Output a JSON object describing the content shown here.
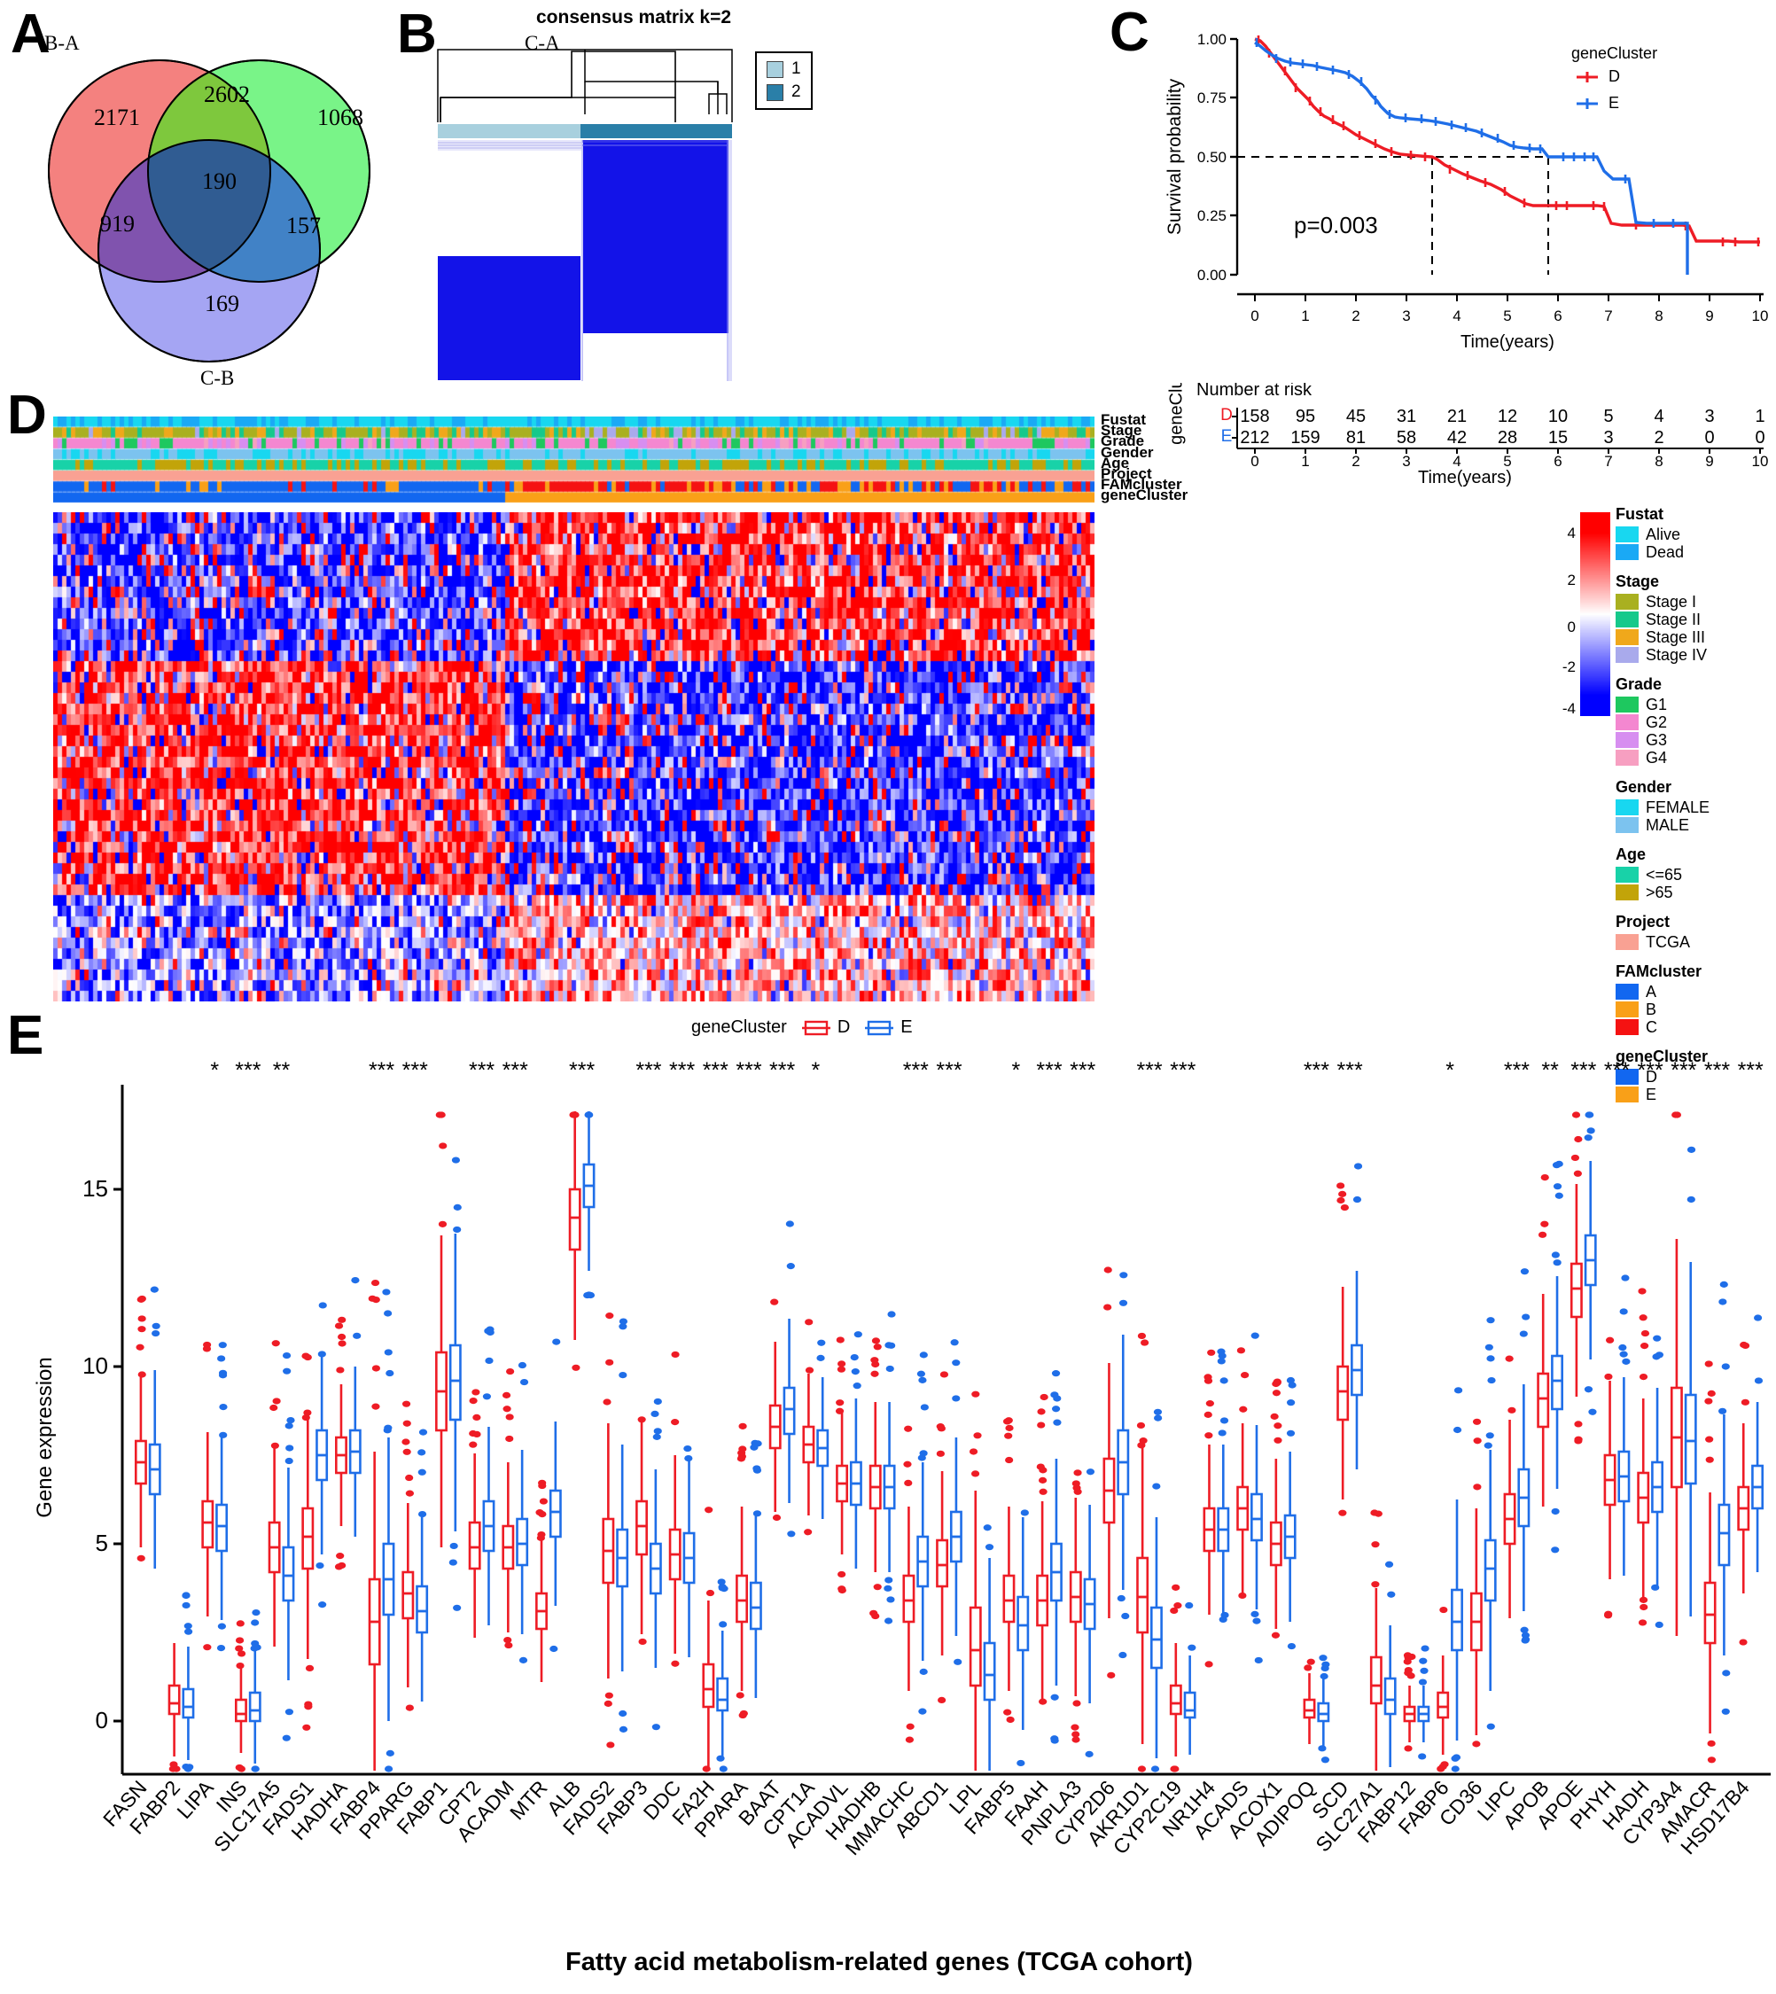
{
  "figure": {
    "panels": [
      "A",
      "B",
      "C",
      "D",
      "E"
    ]
  },
  "panelA": {
    "letter": "A",
    "type": "venn",
    "set_labels": [
      "B-A",
      "C-A",
      "C-B"
    ],
    "regions": [
      {
        "name": "B-A only",
        "value": "2171"
      },
      {
        "name": "B-A ∩ C-A",
        "value": "2602"
      },
      {
        "name": "C-A only",
        "value": "1068"
      },
      {
        "name": "B-A ∩ C-B",
        "value": "919"
      },
      {
        "name": "triple",
        "value": "190"
      },
      {
        "name": "C-A ∩ C-B",
        "value": "157"
      },
      {
        "name": "C-B only",
        "value": "169"
      }
    ],
    "colors": {
      "red": "#f4817f",
      "green": "#66f278",
      "blue": "#8e8ef0"
    }
  },
  "panelB": {
    "letter": "B",
    "title": "consensus matrix k=2",
    "legend_title": "",
    "legend_items": [
      {
        "label": "1",
        "color": "#a8d0de"
      },
      {
        "label": "2",
        "color": "#2a7fa8"
      }
    ],
    "matrix_color": "#1313e8",
    "k": "2"
  },
  "panelC": {
    "letter": "C",
    "ylabel": "Survival probability",
    "xlabel": "Time(years)",
    "pvalue": "p=0.003",
    "ylim": [
      0,
      1
    ],
    "yticks": [
      "0.00",
      "0.25",
      "0.50",
      "0.75",
      "1.00"
    ],
    "xticks": [
      "0",
      "1",
      "2",
      "3",
      "4",
      "5",
      "6",
      "7",
      "8",
      "9",
      "10"
    ],
    "legend_title": "geneCluster",
    "legend_items": [
      {
        "label": "D",
        "color": "#ee1c25"
      },
      {
        "label": "E",
        "color": "#1f6ee8"
      }
    ],
    "median_lines": {
      "y": "0.50",
      "x_D": "3.5",
      "x_E": "5.8"
    },
    "risk_title": "Number at risk",
    "risk_axis_label": "geneCluster",
    "risk_rows": [
      {
        "label": "D",
        "color": "#ee1c25",
        "values": [
          "158",
          "95",
          "45",
          "31",
          "21",
          "12",
          "10",
          "5",
          "4",
          "3",
          "1"
        ]
      },
      {
        "label": "E",
        "color": "#1f6ee8",
        "values": [
          "212",
          "159",
          "81",
          "58",
          "42",
          "28",
          "15",
          "3",
          "2",
          "0",
          "0"
        ]
      }
    ]
  },
  "panelD": {
    "letter": "D",
    "annotation_rows": [
      "Fustat",
      "Stage",
      "Grade",
      "Gender",
      "Age",
      "Project",
      "FAMcluster",
      "geneCluster"
    ],
    "colorbar_ticks": [
      "4",
      "2",
      "0",
      "-2",
      "-4"
    ],
    "legend_groups": [
      {
        "title": "Fustat",
        "items": [
          {
            "label": "Alive",
            "color": "#18d7f0"
          },
          {
            "label": "Dead",
            "color": "#1aa9f5"
          }
        ]
      },
      {
        "title": "Stage",
        "items": [
          {
            "label": "Stage I",
            "color": "#a9b020"
          },
          {
            "label": "Stage II",
            "color": "#16c98b"
          },
          {
            "label": "Stage III",
            "color": "#f0a81b"
          },
          {
            "label": "Stage IV",
            "color": "#a9aaec"
          }
        ]
      },
      {
        "title": "Grade",
        "items": [
          {
            "label": "G1",
            "color": "#1ec85f"
          },
          {
            "label": "G2",
            "color": "#f487d0"
          },
          {
            "label": "G3",
            "color": "#d78ef0"
          },
          {
            "label": "G4",
            "color": "#f79fc1"
          }
        ]
      },
      {
        "title": "Gender",
        "items": [
          {
            "label": "FEMALE",
            "color": "#18d7f0"
          },
          {
            "label": "MALE",
            "color": "#7cc3ef"
          }
        ]
      },
      {
        "title": "Age",
        "items": [
          {
            "label": "<=65",
            "color": "#18d2a8"
          },
          {
            "label": ">65",
            "color": "#c2a409"
          }
        ]
      },
      {
        "title": "Project",
        "items": [
          {
            "label": "TCGA",
            "color": "#f9a193"
          }
        ]
      },
      {
        "title": "FAMcluster",
        "items": [
          {
            "label": "A",
            "color": "#1267f0"
          },
          {
            "label": "B",
            "color": "#f9a018"
          },
          {
            "label": "C",
            "color": "#f51212"
          }
        ]
      },
      {
        "title": "geneCluster",
        "items": [
          {
            "label": "D",
            "color": "#1267f0"
          },
          {
            "label": "E",
            "color": "#f9a018"
          }
        ]
      }
    ]
  },
  "panelE": {
    "letter": "E",
    "ylabel": "Gene expression",
    "xlabel": "Fatty acid metabolism-related genes (TCGA cohort)",
    "legend_title": "geneCluster",
    "legend_items": [
      {
        "label": "D",
        "color": "#ee1c25"
      },
      {
        "label": "E",
        "color": "#1f6ee8"
      }
    ],
    "yticks": [
      "0",
      "5",
      "10",
      "15"
    ],
    "ylim": [
      -1.5,
      17.5
    ],
    "genes": [
      "FASN",
      "FABP2",
      "LIPA",
      "INS",
      "SLC17A5",
      "FADS1",
      "HADHA",
      "FABP4",
      "PPARG",
      "FABP1",
      "CPT2",
      "ACADM",
      "MTR",
      "ALB",
      "FADS2",
      "FABP3",
      "DDC",
      "FA2H",
      "PPARA",
      "BAAT",
      "CPT1A",
      "ACADVL",
      "HADHB",
      "MMACHC",
      "ABCD1",
      "LPL",
      "FABP5",
      "FAAH",
      "PNPLA3",
      "CYP2D6",
      "AKR1D1",
      "CYP2C19",
      "NR1H4",
      "ACADS",
      "ACOX1",
      "ADIPOQ",
      "SCD",
      "SLC27A1",
      "FABP12",
      "FABP6",
      "CD36",
      "LIPC",
      "APOB",
      "APOE",
      "PHYH",
      "HADH",
      "CYP3A4",
      "AMACR",
      "HSD17B4"
    ],
    "significance": [
      "",
      "",
      "*",
      "***",
      "**",
      "",
      "",
      "***",
      "***",
      "",
      "***",
      "***",
      "",
      "***",
      "",
      "***",
      "***",
      "***",
      "***",
      "***",
      "*",
      "",
      "",
      "***",
      "***",
      "",
      "*",
      "***",
      "***",
      "",
      "***",
      "***",
      "",
      "",
      "",
      "***",
      "***",
      "",
      "",
      "*",
      "",
      "***",
      "**",
      "***",
      "***",
      "***",
      "***",
      "***",
      "***"
    ]
  },
  "chart_data": [
    {
      "type": "venn",
      "title": "",
      "sets": [
        "B-A",
        "C-A",
        "C-B"
      ],
      "counts": {
        "B-A_only": 2171,
        "C-A_only": 1068,
        "C-B_only": 169,
        "B-A∩C-A": 2602,
        "B-A∩C-B": 919,
        "C-A∩C-B": 157,
        "all_three": 190
      }
    },
    {
      "type": "heatmap",
      "title": "consensus matrix k=2",
      "categories": [
        "1",
        "2"
      ],
      "legend": [
        "1",
        "2"
      ],
      "xlabel": "",
      "ylabel": ""
    },
    {
      "type": "line",
      "title": "",
      "xlabel": "Time(years)",
      "ylabel": "Survival probability",
      "xlim": [
        0,
        10
      ],
      "ylim": [
        0,
        1
      ],
      "grid": false,
      "legend_position": "right",
      "annotations": [
        "p=0.003",
        "geneCluster"
      ],
      "series": [
        {
          "name": "D",
          "color": "#ee1c25",
          "x": [
            0,
            0.2,
            0.4,
            0.6,
            0.8,
            1.0,
            1.2,
            1.4,
            1.6,
            1.8,
            2.0,
            2.2,
            2.5,
            2.8,
            3.1,
            3.4,
            3.5,
            3.8,
            4.1,
            4.4,
            4.7,
            5.0,
            5.3,
            5.6,
            6.0,
            6.4,
            6.8,
            7.0,
            7.4,
            7.9,
            8.4,
            8.9,
            9.3,
            9.8,
            10.0
          ],
          "y": [
            1.0,
            0.97,
            0.93,
            0.89,
            0.84,
            0.79,
            0.75,
            0.72,
            0.7,
            0.68,
            0.66,
            0.63,
            0.6,
            0.58,
            0.55,
            0.51,
            0.5,
            0.48,
            0.46,
            0.44,
            0.42,
            0.4,
            0.37,
            0.35,
            0.35,
            0.35,
            0.35,
            0.34,
            0.29,
            0.29,
            0.29,
            0.29,
            0.23,
            0.22,
            0.22
          ],
          "at_risk": [
            158,
            95,
            45,
            31,
            21,
            12,
            10,
            5,
            4,
            3,
            1
          ]
        },
        {
          "name": "E",
          "color": "#1f6ee8",
          "x": [
            0,
            0.2,
            0.4,
            0.6,
            0.8,
            1.0,
            1.2,
            1.4,
            1.6,
            1.8,
            2.0,
            2.2,
            2.4,
            2.8,
            3.2,
            3.6,
            4.0,
            4.4,
            4.8,
            5.2,
            5.6,
            5.8,
            6.0,
            6.4,
            6.8,
            7.0,
            7.4,
            7.9,
            8.3,
            8.55,
            8.6
          ],
          "y": [
            1.0,
            0.98,
            0.95,
            0.93,
            0.92,
            0.9,
            0.89,
            0.88,
            0.86,
            0.83,
            0.78,
            0.72,
            0.69,
            0.68,
            0.66,
            0.65,
            0.63,
            0.61,
            0.59,
            0.57,
            0.56,
            0.5,
            0.5,
            0.5,
            0.5,
            0.42,
            0.26,
            0.26,
            0.26,
            0.26,
            0.0
          ],
          "at_risk": [
            212,
            159,
            81,
            58,
            42,
            28,
            15,
            3,
            2,
            0,
            0
          ]
        }
      ],
      "risk_table": {
        "title": "Number at risk",
        "row_label": "geneCluster",
        "xticks": [
          0,
          1,
          2,
          3,
          4,
          5,
          6,
          7,
          8,
          9,
          10
        ],
        "rows": [
          {
            "name": "D",
            "values": [
              158,
              95,
              45,
              31,
              21,
              12,
              10,
              5,
              4,
              3,
              1
            ]
          },
          {
            "name": "E",
            "values": [
              212,
              159,
              81,
              58,
              42,
              28,
              15,
              3,
              2,
              0,
              0
            ]
          }
        ]
      }
    },
    {
      "type": "heatmap",
      "title": "",
      "xlabel": "",
      "ylabel": "",
      "zlim": [
        -4,
        4
      ],
      "colorbar_ticks": [
        4,
        2,
        0,
        -2,
        -4
      ],
      "annotation_tracks": [
        "Fustat",
        "Stage",
        "Grade",
        "Gender",
        "Age",
        "Project",
        "FAMcluster",
        "geneCluster"
      ],
      "column_groups": [
        {
          "name": "D",
          "fraction": 0.44
        },
        {
          "name": "E",
          "fraction": 0.56
        }
      ]
    },
    {
      "type": "boxplot",
      "title": "",
      "xlabel": "Fatty acid metabolism-related genes (TCGA cohort)",
      "ylabel": "Gene expression",
      "ylim": [
        -1.5,
        17.5
      ],
      "yticks": [
        0,
        5,
        10,
        15
      ],
      "legend_position": "top",
      "legend": [
        "D",
        "E"
      ],
      "categories": [
        "FASN",
        "FABP2",
        "LIPA",
        "INS",
        "SLC17A5",
        "FADS1",
        "HADHA",
        "FABP4",
        "PPARG",
        "FABP1",
        "CPT2",
        "ACADM",
        "MTR",
        "ALB",
        "FADS2",
        "FABP3",
        "DDC",
        "FA2H",
        "PPARA",
        "BAAT",
        "CPT1A",
        "ACADVL",
        "HADHB",
        "MMACHC",
        "ABCD1",
        "LPL",
        "FABP5",
        "FAAH",
        "PNPLA3",
        "CYP2D6",
        "AKR1D1",
        "CYP2C19",
        "NR1H4",
        "ACADS",
        "ACOX1",
        "ADIPOQ",
        "SCD",
        "SLC27A1",
        "FABP12",
        "FABP6",
        "CD36",
        "LIPC",
        "APOB",
        "APOE",
        "PHYH",
        "HADH",
        "CYP3A4",
        "AMACR",
        "HSD17B4"
      ],
      "significance": [
        "",
        "",
        "*",
        "***",
        "**",
        "",
        "",
        "***",
        "***",
        "",
        "***",
        "***",
        "",
        "***",
        "",
        "***",
        "***",
        "***",
        "***",
        "***",
        "*",
        "",
        "",
        "***",
        "***",
        "",
        "*",
        "***",
        "***",
        "",
        "***",
        "***",
        "",
        "",
        "",
        "***",
        "***",
        "",
        "",
        "*",
        "",
        "***",
        "**",
        "***",
        "***",
        "***",
        "***",
        "***",
        "***"
      ],
      "series": [
        {
          "name": "D",
          "color": "#ee1c25",
          "median": [
            7.3,
            0.5,
            5.6,
            0.2,
            4.9,
            5.2,
            7.5,
            2.8,
            3.6,
            9.3,
            4.9,
            4.9,
            3.1,
            14.2,
            4.8,
            5.5,
            4.7,
            0.9,
            3.4,
            8.3,
            7.8,
            6.7,
            6.6,
            3.4,
            4.4,
            2.0,
            3.4,
            3.4,
            3.5,
            6.5,
            3.5,
            0.5,
            5.4,
            6.0,
            5.0,
            0.3,
            9.3,
            1.0,
            0.2,
            0.4,
            2.8,
            5.7,
            9.1,
            12.2,
            6.8,
            6.3,
            8.0,
            3.0,
            6.0
          ],
          "q1": [
            6.7,
            0.2,
            4.9,
            0.0,
            4.2,
            4.3,
            7.0,
            1.6,
            2.9,
            8.2,
            4.3,
            4.3,
            2.6,
            13.3,
            3.9,
            4.7,
            4.0,
            0.4,
            2.8,
            7.7,
            7.3,
            6.2,
            6.0,
            2.8,
            3.8,
            1.0,
            2.8,
            2.7,
            2.8,
            5.6,
            2.5,
            0.2,
            4.8,
            5.4,
            4.4,
            0.1,
            8.5,
            0.5,
            0.0,
            0.1,
            2.0,
            5.0,
            8.3,
            11.4,
            6.1,
            5.6,
            6.6,
            2.2,
            5.4
          ],
          "q3": [
            7.9,
            1.0,
            6.2,
            0.6,
            5.6,
            6.0,
            8.0,
            4.0,
            4.2,
            10.4,
            5.6,
            5.5,
            3.6,
            15.0,
            5.7,
            6.2,
            5.4,
            1.6,
            4.1,
            8.9,
            8.3,
            7.2,
            7.2,
            4.1,
            5.1,
            3.2,
            4.1,
            4.1,
            4.2,
            7.4,
            4.6,
            1.0,
            6.0,
            6.6,
            5.6,
            0.6,
            10.0,
            1.8,
            0.4,
            0.8,
            3.6,
            6.4,
            9.8,
            12.9,
            7.5,
            7.0,
            9.4,
            3.9,
            6.6
          ]
        },
        {
          "name": "E",
          "color": "#1f6ee8",
          "median": [
            7.1,
            0.4,
            5.5,
            0.3,
            4.1,
            7.5,
            7.6,
            4.0,
            3.1,
            9.6,
            5.5,
            5.0,
            5.9,
            15.1,
            4.6,
            4.3,
            4.6,
            0.6,
            3.2,
            8.8,
            7.7,
            6.7,
            6.6,
            4.5,
            5.2,
            1.3,
            2.7,
            4.2,
            3.3,
            7.3,
            2.3,
            0.3,
            5.4,
            5.7,
            5.2,
            0.2,
            9.9,
            0.6,
            0.2,
            2.8,
            4.3,
            6.3,
            9.6,
            13.0,
            6.9,
            6.6,
            7.9,
            5.3,
            6.6
          ],
          "q1": [
            6.4,
            0.1,
            4.8,
            0.0,
            3.4,
            6.8,
            7.0,
            3.0,
            2.5,
            8.5,
            4.8,
            4.4,
            5.2,
            14.5,
            3.8,
            3.6,
            3.9,
            0.3,
            2.6,
            8.1,
            7.2,
            6.1,
            6.0,
            3.8,
            4.5,
            0.6,
            2.0,
            3.4,
            2.6,
            6.4,
            1.5,
            0.1,
            4.8,
            5.1,
            4.6,
            0.0,
            9.2,
            0.2,
            0.0,
            2.0,
            3.4,
            5.5,
            8.8,
            12.3,
            6.2,
            5.9,
            6.7,
            4.4,
            6.0
          ],
          "q3": [
            7.8,
            0.9,
            6.1,
            0.8,
            4.9,
            8.2,
            8.2,
            5.0,
            3.8,
            10.6,
            6.2,
            5.7,
            6.5,
            15.7,
            5.4,
            5.0,
            5.3,
            1.2,
            3.9,
            9.4,
            8.2,
            7.3,
            7.2,
            5.2,
            5.9,
            2.2,
            3.5,
            5.0,
            4.0,
            8.2,
            3.2,
            0.8,
            6.0,
            6.4,
            5.8,
            0.5,
            10.6,
            1.2,
            0.4,
            3.7,
            5.1,
            7.1,
            10.3,
            13.7,
            7.6,
            7.3,
            9.2,
            6.1,
            7.2
          ]
        }
      ]
    }
  ]
}
